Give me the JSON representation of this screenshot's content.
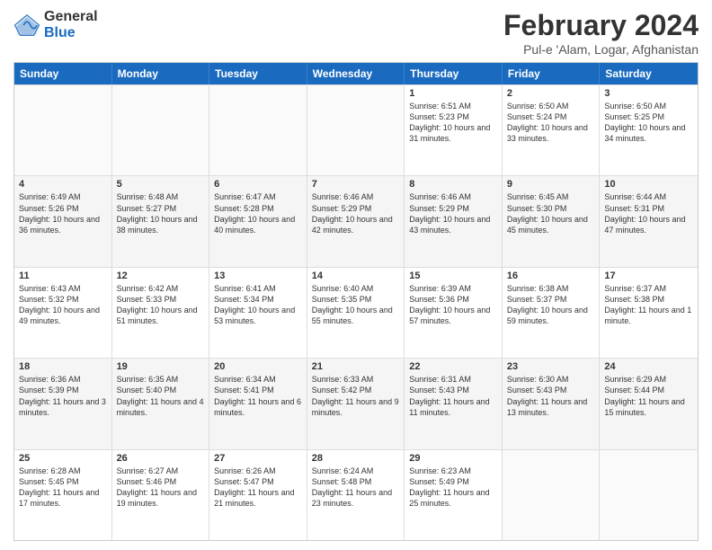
{
  "logo": {
    "general": "General",
    "blue": "Blue"
  },
  "title": {
    "month_year": "February 2024",
    "location": "Pul-e 'Alam, Logar, Afghanistan"
  },
  "header_days": [
    "Sunday",
    "Monday",
    "Tuesday",
    "Wednesday",
    "Thursday",
    "Friday",
    "Saturday"
  ],
  "weeks": [
    [
      {
        "day": "",
        "info": "",
        "shaded": false
      },
      {
        "day": "",
        "info": "",
        "shaded": false
      },
      {
        "day": "",
        "info": "",
        "shaded": false
      },
      {
        "day": "",
        "info": "",
        "shaded": false
      },
      {
        "day": "1",
        "info": "Sunrise: 6:51 AM\nSunset: 5:23 PM\nDaylight: 10 hours and 31 minutes.",
        "shaded": false
      },
      {
        "day": "2",
        "info": "Sunrise: 6:50 AM\nSunset: 5:24 PM\nDaylight: 10 hours and 33 minutes.",
        "shaded": false
      },
      {
        "day": "3",
        "info": "Sunrise: 6:50 AM\nSunset: 5:25 PM\nDaylight: 10 hours and 34 minutes.",
        "shaded": false
      }
    ],
    [
      {
        "day": "4",
        "info": "Sunrise: 6:49 AM\nSunset: 5:26 PM\nDaylight: 10 hours and 36 minutes.",
        "shaded": true
      },
      {
        "day": "5",
        "info": "Sunrise: 6:48 AM\nSunset: 5:27 PM\nDaylight: 10 hours and 38 minutes.",
        "shaded": true
      },
      {
        "day": "6",
        "info": "Sunrise: 6:47 AM\nSunset: 5:28 PM\nDaylight: 10 hours and 40 minutes.",
        "shaded": true
      },
      {
        "day": "7",
        "info": "Sunrise: 6:46 AM\nSunset: 5:29 PM\nDaylight: 10 hours and 42 minutes.",
        "shaded": true
      },
      {
        "day": "8",
        "info": "Sunrise: 6:46 AM\nSunset: 5:29 PM\nDaylight: 10 hours and 43 minutes.",
        "shaded": true
      },
      {
        "day": "9",
        "info": "Sunrise: 6:45 AM\nSunset: 5:30 PM\nDaylight: 10 hours and 45 minutes.",
        "shaded": true
      },
      {
        "day": "10",
        "info": "Sunrise: 6:44 AM\nSunset: 5:31 PM\nDaylight: 10 hours and 47 minutes.",
        "shaded": true
      }
    ],
    [
      {
        "day": "11",
        "info": "Sunrise: 6:43 AM\nSunset: 5:32 PM\nDaylight: 10 hours and 49 minutes.",
        "shaded": false
      },
      {
        "day": "12",
        "info": "Sunrise: 6:42 AM\nSunset: 5:33 PM\nDaylight: 10 hours and 51 minutes.",
        "shaded": false
      },
      {
        "day": "13",
        "info": "Sunrise: 6:41 AM\nSunset: 5:34 PM\nDaylight: 10 hours and 53 minutes.",
        "shaded": false
      },
      {
        "day": "14",
        "info": "Sunrise: 6:40 AM\nSunset: 5:35 PM\nDaylight: 10 hours and 55 minutes.",
        "shaded": false
      },
      {
        "day": "15",
        "info": "Sunrise: 6:39 AM\nSunset: 5:36 PM\nDaylight: 10 hours and 57 minutes.",
        "shaded": false
      },
      {
        "day": "16",
        "info": "Sunrise: 6:38 AM\nSunset: 5:37 PM\nDaylight: 10 hours and 59 minutes.",
        "shaded": false
      },
      {
        "day": "17",
        "info": "Sunrise: 6:37 AM\nSunset: 5:38 PM\nDaylight: 11 hours and 1 minute.",
        "shaded": false
      }
    ],
    [
      {
        "day": "18",
        "info": "Sunrise: 6:36 AM\nSunset: 5:39 PM\nDaylight: 11 hours and 3 minutes.",
        "shaded": true
      },
      {
        "day": "19",
        "info": "Sunrise: 6:35 AM\nSunset: 5:40 PM\nDaylight: 11 hours and 4 minutes.",
        "shaded": true
      },
      {
        "day": "20",
        "info": "Sunrise: 6:34 AM\nSunset: 5:41 PM\nDaylight: 11 hours and 6 minutes.",
        "shaded": true
      },
      {
        "day": "21",
        "info": "Sunrise: 6:33 AM\nSunset: 5:42 PM\nDaylight: 11 hours and 9 minutes.",
        "shaded": true
      },
      {
        "day": "22",
        "info": "Sunrise: 6:31 AM\nSunset: 5:43 PM\nDaylight: 11 hours and 11 minutes.",
        "shaded": true
      },
      {
        "day": "23",
        "info": "Sunrise: 6:30 AM\nSunset: 5:43 PM\nDaylight: 11 hours and 13 minutes.",
        "shaded": true
      },
      {
        "day": "24",
        "info": "Sunrise: 6:29 AM\nSunset: 5:44 PM\nDaylight: 11 hours and 15 minutes.",
        "shaded": true
      }
    ],
    [
      {
        "day": "25",
        "info": "Sunrise: 6:28 AM\nSunset: 5:45 PM\nDaylight: 11 hours and 17 minutes.",
        "shaded": false
      },
      {
        "day": "26",
        "info": "Sunrise: 6:27 AM\nSunset: 5:46 PM\nDaylight: 11 hours and 19 minutes.",
        "shaded": false
      },
      {
        "day": "27",
        "info": "Sunrise: 6:26 AM\nSunset: 5:47 PM\nDaylight: 11 hours and 21 minutes.",
        "shaded": false
      },
      {
        "day": "28",
        "info": "Sunrise: 6:24 AM\nSunset: 5:48 PM\nDaylight: 11 hours and 23 minutes.",
        "shaded": false
      },
      {
        "day": "29",
        "info": "Sunrise: 6:23 AM\nSunset: 5:49 PM\nDaylight: 11 hours and 25 minutes.",
        "shaded": false
      },
      {
        "day": "",
        "info": "",
        "shaded": false
      },
      {
        "day": "",
        "info": "",
        "shaded": false
      }
    ]
  ]
}
